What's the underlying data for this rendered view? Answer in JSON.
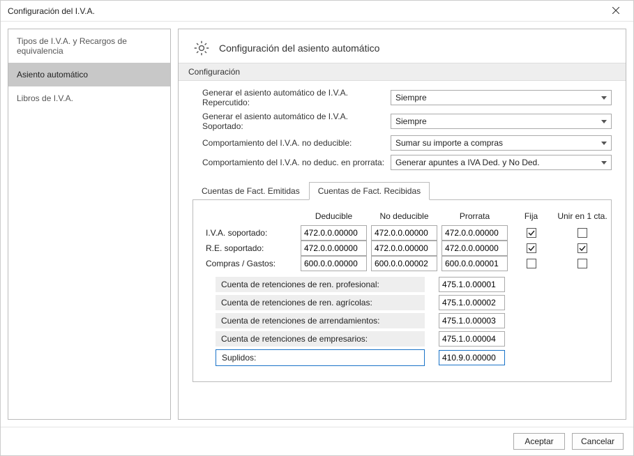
{
  "window": {
    "title": "Configuración del I.V.A."
  },
  "sidebar": {
    "items": [
      {
        "label": "Tipos de I.V.A. y Recargos de equivalencia",
        "selected": false
      },
      {
        "label": "Asiento automático",
        "selected": true
      },
      {
        "label": "Libros de I.V.A.",
        "selected": false
      }
    ]
  },
  "main": {
    "title": "Configuración del asiento automático",
    "section": "Configuración",
    "form": {
      "rows": [
        {
          "label": "Generar el asiento automático de I.V.A. Repercutido:",
          "value": "Siempre"
        },
        {
          "label": "Generar el asiento automático de I.V.A. Soportado:",
          "value": "Siempre"
        },
        {
          "label": "Comportamiento del I.V.A. no deducible:",
          "value": "Sumar su importe a compras"
        },
        {
          "label": "Comportamiento del I.V.A. no deduc. en prorrata:",
          "value": "Generar apuntes a IVA Ded. y No Ded."
        }
      ]
    },
    "tabs": [
      {
        "label": "Cuentas de Fact. Emitidas",
        "active": false
      },
      {
        "label": "Cuentas de Fact. Recibidas",
        "active": true
      }
    ],
    "grid": {
      "headers": {
        "deducible": "Deducible",
        "nodeducible": "No deducible",
        "prorrata": "Prorrata",
        "fija": "Fija",
        "unir": "Unir en 1 cta."
      },
      "rows": [
        {
          "label": "I.V.A. soportado:",
          "deducible": "472.0.0.00000",
          "nodeducible": "472.0.0.00000",
          "prorrata": "472.0.0.00000",
          "fija": true,
          "unir": false
        },
        {
          "label": "R.E. soportado:",
          "deducible": "472.0.0.00000",
          "nodeducible": "472.0.0.00000",
          "prorrata": "472.0.0.00000",
          "fija": true,
          "unir": true
        },
        {
          "label": "Compras / Gastos:",
          "deducible": "600.0.0.00000",
          "nodeducible": "600.0.0.00002",
          "prorrata": "600.0.0.00001",
          "fija": false,
          "unir": false
        }
      ]
    },
    "retenciones": [
      {
        "label": "Cuenta de retenciones de ren. profesional:",
        "value": "475.1.0.00001",
        "highlight": false
      },
      {
        "label": "Cuenta de retenciones de ren. agrícolas:",
        "value": "475.1.0.00002",
        "highlight": false
      },
      {
        "label": "Cuenta de retenciones de arrendamientos:",
        "value": "475.1.0.00003",
        "highlight": false
      },
      {
        "label": "Cuenta de retenciones de empresarios:",
        "value": "475.1.0.00004",
        "highlight": false
      },
      {
        "label": "Suplidos:",
        "value": "410.9.0.00000",
        "highlight": true
      }
    ]
  },
  "footer": {
    "accept": "Aceptar",
    "cancel": "Cancelar"
  }
}
